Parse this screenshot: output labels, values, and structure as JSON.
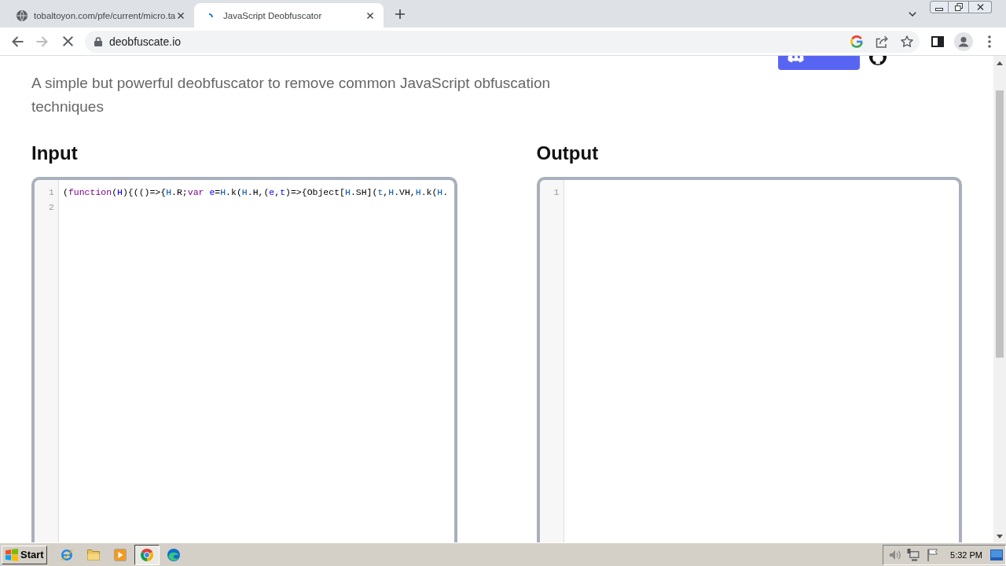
{
  "browser": {
    "tabs": [
      {
        "title": "tobaltoyon.com/pfe/current/micro.ta",
        "selected": false,
        "loading": false
      },
      {
        "title": "JavaScript Deobfuscator",
        "selected": true,
        "loading": true
      }
    ],
    "toolbar": {
      "back_disabled": false,
      "forward_disabled": true
    },
    "address": "deobfuscate.io"
  },
  "page": {
    "subtitle": "A simple but powerful deobfuscator to remove common JavaScript obfuscation techniques",
    "links": [
      {
        "kind": "discord"
      },
      {
        "kind": "github"
      }
    ],
    "editors": [
      {
        "heading": "Input",
        "lines": [
          {
            "number": "1",
            "tokens": [
              {
                "text": "(",
                "kind": "plain"
              },
              {
                "text": "function",
                "kind": "keyword"
              },
              {
                "text": "(",
                "kind": "plain"
              },
              {
                "text": "H",
                "kind": "def"
              },
              {
                "text": "){(()=>{",
                "kind": "plain"
              },
              {
                "text": "H",
                "kind": "variable"
              },
              {
                "text": ".R;",
                "kind": "plain"
              },
              {
                "text": "var ",
                "kind": "keyword"
              },
              {
                "text": "e",
                "kind": "def"
              },
              {
                "text": "=",
                "kind": "plain"
              },
              {
                "text": "H",
                "kind": "variable"
              },
              {
                "text": ".k(",
                "kind": "plain"
              },
              {
                "text": "H",
                "kind": "variable"
              },
              {
                "text": ".H,(",
                "kind": "plain"
              },
              {
                "text": "e",
                "kind": "def"
              },
              {
                "text": ",",
                "kind": "plain"
              },
              {
                "text": "t",
                "kind": "def"
              },
              {
                "text": ")=>{Object[",
                "kind": "plain"
              },
              {
                "text": "H",
                "kind": "variable"
              },
              {
                "text": ".SH](",
                "kind": "plain"
              },
              {
                "text": "t",
                "kind": "variable"
              },
              {
                "text": ",",
                "kind": "plain"
              },
              {
                "text": "H",
                "kind": "variable"
              },
              {
                "text": ".VH,",
                "kind": "plain"
              },
              {
                "text": "H",
                "kind": "variable"
              },
              {
                "text": ".k(",
                "kind": "plain"
              },
              {
                "text": "H",
                "kind": "variable"
              },
              {
                "text": ".",
                "kind": "plain"
              }
            ]
          },
          {
            "number": "2"
          }
        ]
      },
      {
        "heading": "Output",
        "lines": [
          {
            "number": "1"
          }
        ]
      }
    ]
  },
  "taskbar": {
    "start": "Start",
    "apps": [
      {
        "kind": "explorer",
        "selected": false
      },
      {
        "kind": "files",
        "selected": false
      },
      {
        "kind": "media",
        "selected": false
      },
      {
        "kind": "chrome",
        "selected": true
      },
      {
        "kind": "edge",
        "selected": false
      }
    ],
    "clock": "5:32 PM"
  }
}
